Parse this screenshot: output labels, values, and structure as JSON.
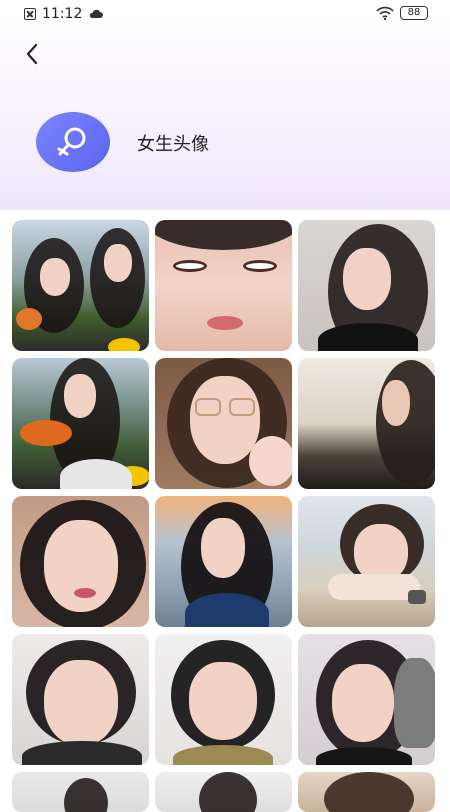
{
  "status_bar": {
    "time": "11:12",
    "battery": "88"
  },
  "header": {
    "title": "女生头像"
  },
  "colors": {
    "accent": "#6a73f5",
    "header_tint": "#efe6fb"
  },
  "icons": {
    "back": "chevron-left-icon",
    "category": "female-symbol-icon",
    "wifi": "wifi-icon",
    "cloud": "cloud-icon"
  },
  "avatars": [
    {
      "name": "avatar-1"
    },
    {
      "name": "avatar-2"
    },
    {
      "name": "avatar-3"
    },
    {
      "name": "avatar-4"
    },
    {
      "name": "avatar-5"
    },
    {
      "name": "avatar-6"
    },
    {
      "name": "avatar-7"
    },
    {
      "name": "avatar-8"
    },
    {
      "name": "avatar-9"
    },
    {
      "name": "avatar-10"
    },
    {
      "name": "avatar-11"
    },
    {
      "name": "avatar-12"
    },
    {
      "name": "avatar-13"
    },
    {
      "name": "avatar-14"
    },
    {
      "name": "avatar-15"
    }
  ]
}
